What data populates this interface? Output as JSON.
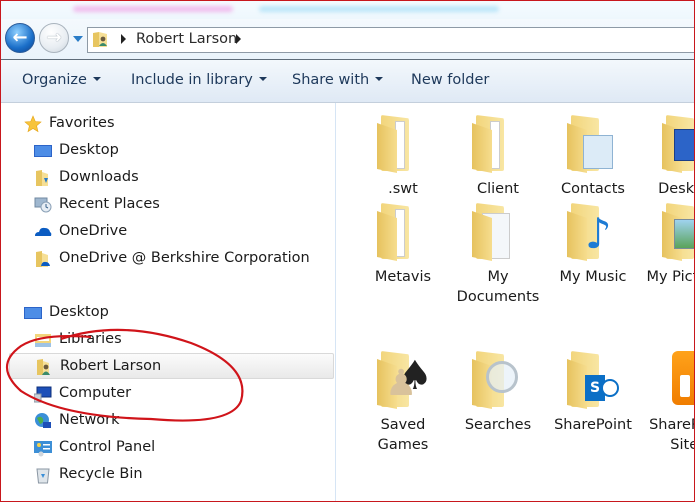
{
  "window": {
    "address_bar": {
      "breadcrumbs": [
        {
          "label": "Robert Larson"
        }
      ],
      "location_icon": "user-folder-icon"
    },
    "nav_buttons": {
      "back": "back-arrow-icon",
      "forward": "forward-arrow-icon",
      "recent": "dropdown-caret-icon"
    }
  },
  "toolbar": {
    "organize_label": "Organize",
    "include_label": "Include in library",
    "share_label": "Share with",
    "new_folder_label": "New folder"
  },
  "nav_pane": {
    "favorites": {
      "header": "Favorites",
      "items": [
        {
          "label": "Desktop",
          "icon": "desktop-icon"
        },
        {
          "label": "Downloads",
          "icon": "downloads-folder-icon"
        },
        {
          "label": "Recent Places",
          "icon": "recent-places-icon"
        },
        {
          "label": "OneDrive",
          "icon": "onedrive-cloud-icon"
        },
        {
          "label": "OneDrive @ Berkshire Corporation",
          "icon": "onedrive-folder-icon"
        }
      ]
    },
    "desktop": {
      "header": "Desktop",
      "items": [
        {
          "label": "Libraries",
          "icon": "libraries-icon"
        },
        {
          "label": "Robert Larson",
          "icon": "user-folder-icon",
          "selected": true
        },
        {
          "label": "Computer",
          "icon": "computer-icon"
        },
        {
          "label": "Network",
          "icon": "network-icon"
        },
        {
          "label": "Control Panel",
          "icon": "control-panel-icon"
        },
        {
          "label": "Recycle Bin",
          "icon": "recycle-bin-icon"
        }
      ]
    }
  },
  "content": {
    "items": [
      {
        "name": ".swt",
        "icon": "folder-icon"
      },
      {
        "name": "Client",
        "icon": "folder-icon"
      },
      {
        "name": "Contacts",
        "icon": "contacts-folder-icon"
      },
      {
        "name": "Desktop",
        "icon": "desktop-folder-icon"
      },
      {
        "name": "Metavis",
        "icon": "folder-icon"
      },
      {
        "name": "My Documents",
        "icon": "documents-folder-icon"
      },
      {
        "name": "My Music",
        "icon": "music-folder-icon"
      },
      {
        "name": "My Pictures",
        "icon": "pictures-folder-icon"
      },
      {
        "name": "Saved Games",
        "icon": "saved-games-folder-icon"
      },
      {
        "name": "Searches",
        "icon": "searches-folder-icon"
      },
      {
        "name": "SharePoint",
        "icon": "sharepoint-folder-icon"
      },
      {
        "name": "SharePoint Sites",
        "icon": "sharepoint-sites-icon"
      }
    ]
  },
  "annotation": {
    "color": "#d0141a",
    "shape": "hand-drawn ellipse around Libraries, Robert Larson, Computer"
  },
  "colors": {
    "toolbar_text": "#1e395b",
    "frame_border": "#c8171d",
    "accent_blue": "#2a7cc7"
  }
}
